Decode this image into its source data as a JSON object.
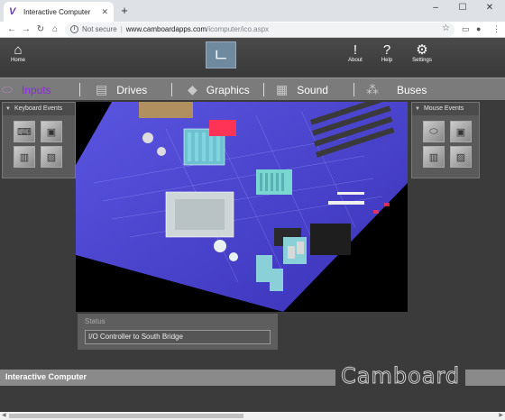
{
  "browser": {
    "tab_title": "Interactive Computer",
    "new_tab": "+",
    "security_label": "Not secure",
    "url_host": "www.camboardapps.com",
    "url_path": "/icomputer/ico.aspx",
    "window_controls": [
      "–",
      "☐",
      "✕"
    ]
  },
  "header": {
    "home_label": "Home",
    "about_label": "About",
    "help_label": "Help",
    "settings_label": "Settings",
    "logo_glyph": "ㄴ"
  },
  "categories": [
    {
      "label": "Inputs",
      "active": true
    },
    {
      "label": "Drives",
      "active": false
    },
    {
      "label": "Graphics",
      "active": false
    },
    {
      "label": "Sound",
      "active": false
    },
    {
      "label": "Buses",
      "active": false
    }
  ],
  "left_panel": {
    "title": "Keyboard Events"
  },
  "right_panel": {
    "title": "Mouse Events"
  },
  "status": {
    "label": "Status",
    "value": "I/O Controller to South Bridge"
  },
  "footer": {
    "title": "Interactive Computer",
    "brand": "Camboard"
  },
  "colors": {
    "active_tab": "#8a2be2",
    "board": "#4a3fd0",
    "highlight": "#ff3355"
  }
}
